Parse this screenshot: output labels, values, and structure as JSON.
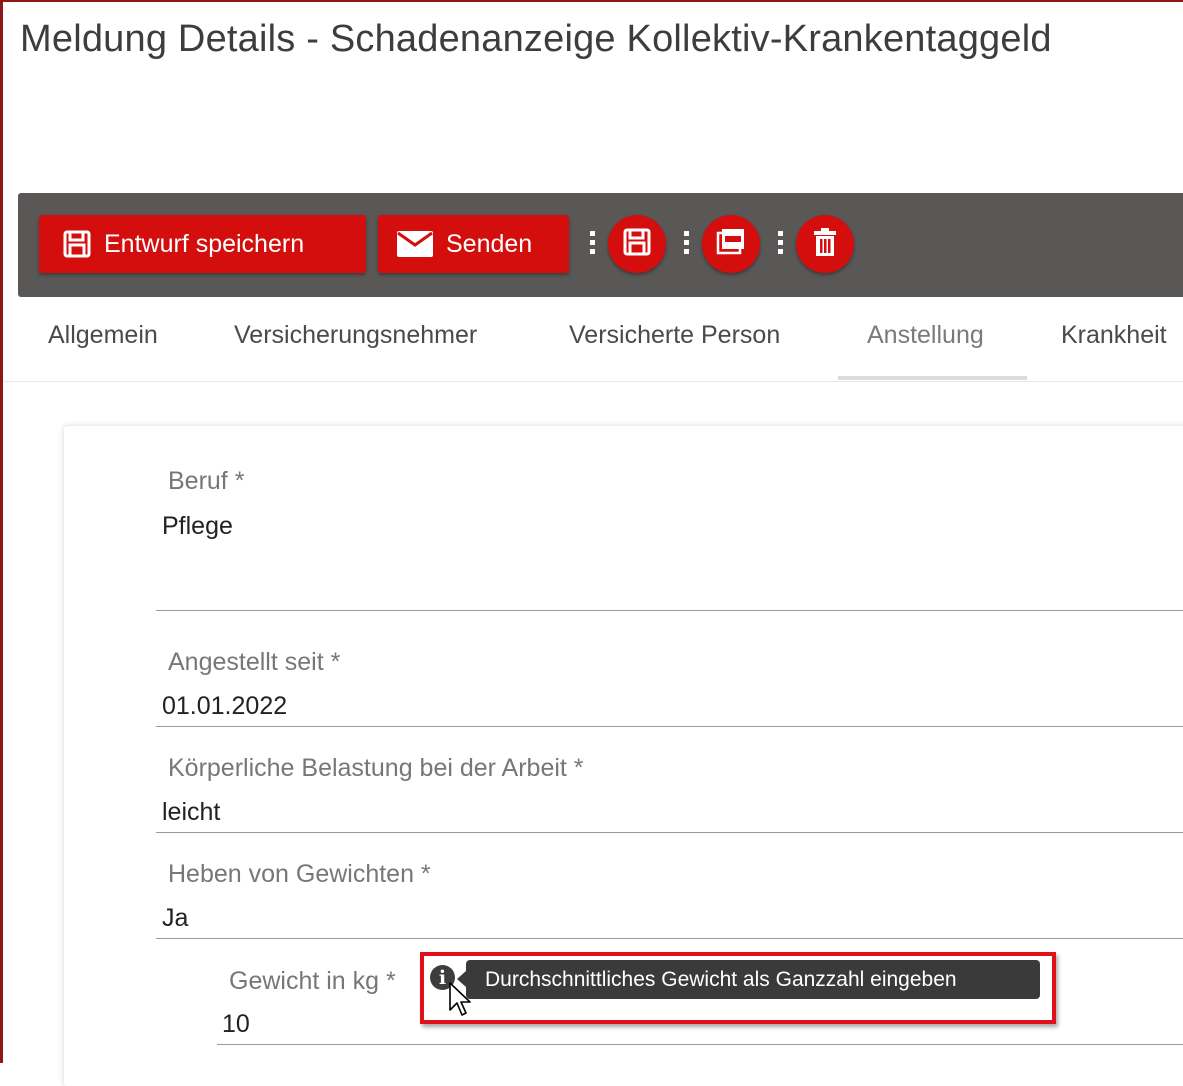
{
  "page": {
    "title": "Meldung Details - Schadenanzeige Kollektiv-Krankentaggeld"
  },
  "toolbar": {
    "save_draft_label": "Entwurf speichern",
    "send_label": "Senden",
    "icons": [
      "save-icon",
      "envelope-icon",
      "floppy-icon",
      "pdf-icon",
      "trash-icon"
    ]
  },
  "tabs": [
    {
      "label": "Allgemein"
    },
    {
      "label": "Versicherungsnehmer"
    },
    {
      "label": "Versicherte Person"
    },
    {
      "label": "Anstellung",
      "active": true
    },
    {
      "label": "Krankheit"
    }
  ],
  "form": {
    "beruf": {
      "label": "Beruf *",
      "value": "Pflege"
    },
    "angestellt_seit": {
      "label": "Angestellt seit *",
      "value": "01.01.2022"
    },
    "belastung": {
      "label": "Körperliche Belastung bei der Arbeit *",
      "value": "leicht"
    },
    "heben": {
      "label": "Heben von Gewichten *",
      "value": "Ja"
    },
    "gewicht": {
      "label": "Gewicht in kg *",
      "value": "10"
    }
  },
  "tooltip": {
    "text": "Durchschnittliches Gewicht als Ganzzahl eingeben"
  },
  "colors": {
    "brand_red": "#d40d0d",
    "toolbar_bg": "#5a5757",
    "highlight": "#e0101a"
  }
}
